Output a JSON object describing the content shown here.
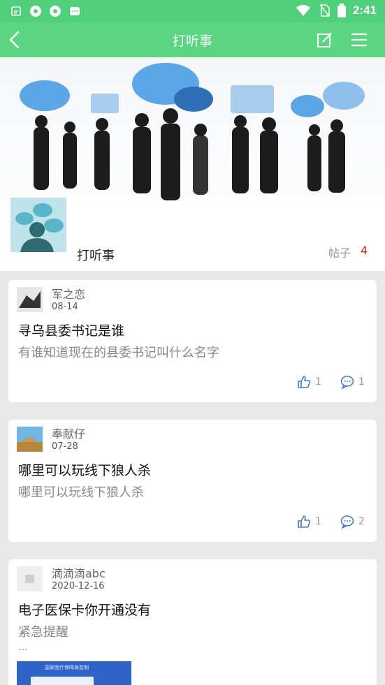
{
  "status_bar": {
    "time": "2:41"
  },
  "app_bar": {
    "title": "打听事"
  },
  "group": {
    "name": "打听事",
    "posts_label": "帖子",
    "posts_count": "4"
  },
  "posts": [
    {
      "user": "军之恋",
      "date": "08-14",
      "title": "寻乌县委书记是谁",
      "body": "有谁知道现在的县委书记叫什么名字",
      "likes": "1",
      "comments": "1"
    },
    {
      "user": "奉献仔",
      "date": "07-28",
      "title": "哪里可以玩线下狼人杀",
      "body": "哪里可以玩线下狼人杀",
      "likes": "1",
      "comments": "2"
    },
    {
      "user": "滴滴滴abc",
      "date": "2020-12-16",
      "title": "电子医保卡你开通没有",
      "body": "紧急提醒",
      "more": "...",
      "image_caption": "国家医疗保障局监制"
    }
  ],
  "colors": {
    "accent": "#5cd582",
    "status": "#4fcf79",
    "count": "#e02020",
    "action_blue": "#4a7cc0"
  }
}
